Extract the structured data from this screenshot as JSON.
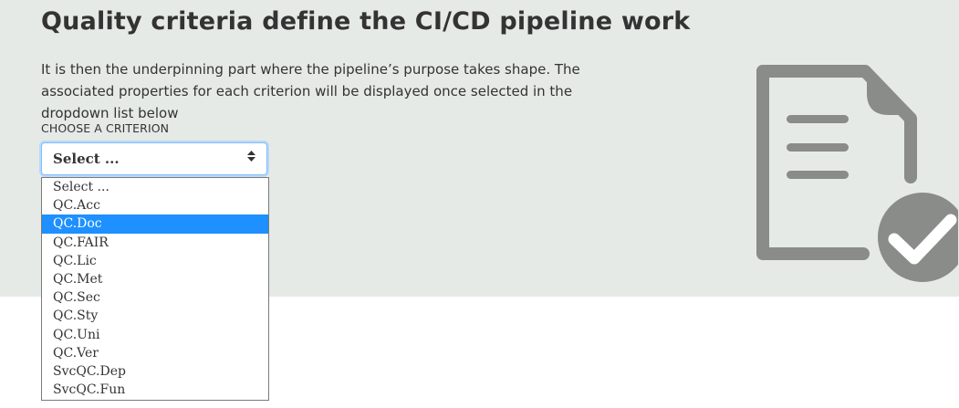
{
  "page": {
    "title": "Quality criteria define the CI/CD pipeline work",
    "intro": "It is then the underpinning part where the pipeline’s purpose takes shape. The associated properties for each criterion will be displayed once selected in the dropdown list below"
  },
  "criterion": {
    "label": "CHOOSE A CRITERION",
    "selected_value": "Select ...",
    "highlighted_option": "QC.Doc",
    "options": [
      "Select ...",
      "QC.Acc",
      "QC.Doc",
      "QC.FAIR",
      "QC.Lic",
      "QC.Met",
      "QC.Sec",
      "QC.Sty",
      "QC.Uni",
      "QC.Ver",
      "SvcQC.Dep",
      "SvcQC.Fun"
    ]
  },
  "icons": {
    "dropdown_arrow": "sort-arrows-icon",
    "illustration": "document-checkmark-icon"
  },
  "colors": {
    "hero_background": "#e5eae7",
    "highlight": "#1e90ff",
    "icon_gray": "#898c89",
    "focus_border": "#80bdff"
  }
}
